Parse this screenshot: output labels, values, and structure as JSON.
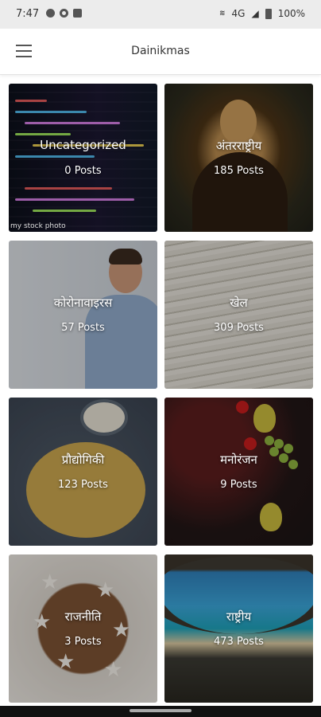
{
  "status_bar": {
    "time": "7:47",
    "network": "4G",
    "battery": "100%"
  },
  "app_bar": {
    "title": "Dainikmas"
  },
  "categories": [
    {
      "name": "Uncategorized",
      "count": "0 Posts",
      "credit": "my stock photo"
    },
    {
      "name": "अंतरराष्ट्रीय",
      "count": "185 Posts"
    },
    {
      "name": "कोरोनावाइरस",
      "count": "57 Posts"
    },
    {
      "name": "खेल",
      "count": "309 Posts"
    },
    {
      "name": "प्रौद्योगिकी",
      "count": "123 Posts"
    },
    {
      "name": "मनोरंजन",
      "count": "9 Posts"
    },
    {
      "name": "राजनीति",
      "count": "3 Posts"
    },
    {
      "name": "राष्ट्रीय",
      "count": "473 Posts"
    }
  ]
}
